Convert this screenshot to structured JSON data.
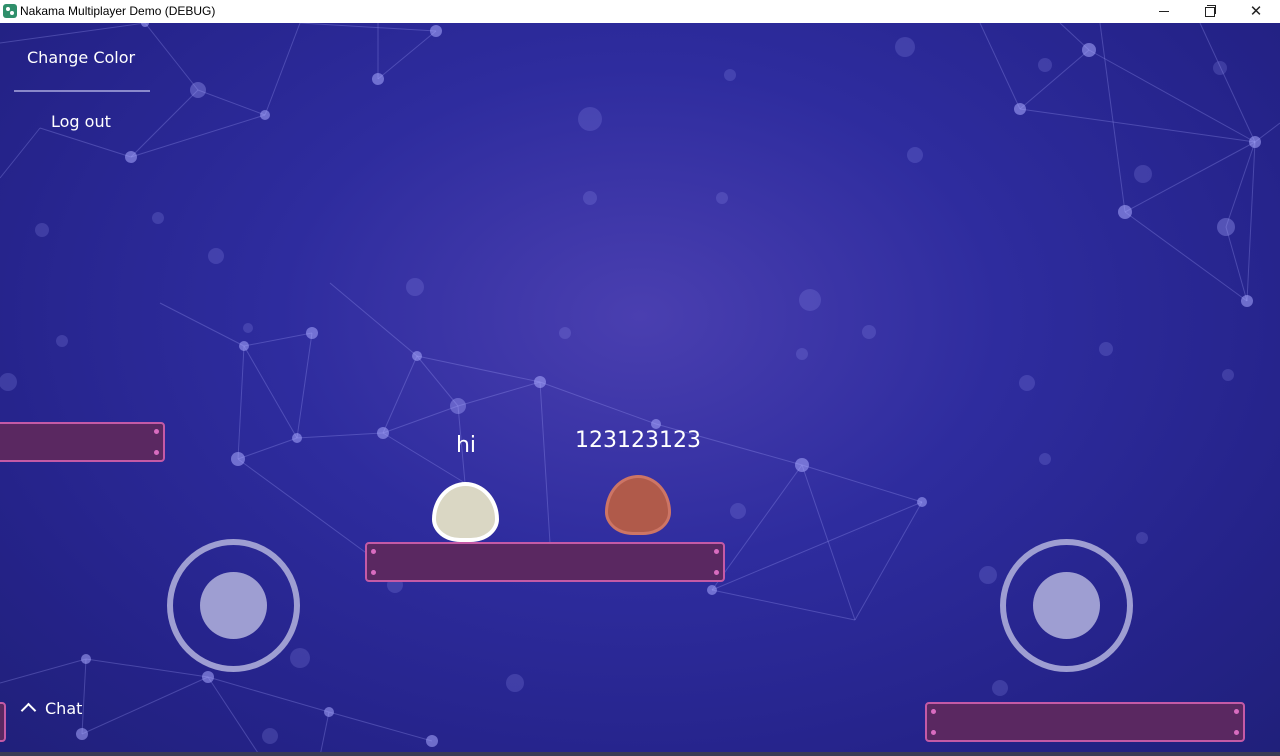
{
  "window": {
    "title": "Nakama Multiplayer Demo (DEBUG)",
    "minimize_glyph": "",
    "maximize_glyph": "",
    "close_glyph": "✕"
  },
  "menu": {
    "change_color": "Change Color",
    "log_out": "Log out"
  },
  "players": [
    {
      "name": "hi",
      "color": "#dad7c4",
      "outline": "#ffffff"
    },
    {
      "name": "123123123",
      "color": "#b05a4a",
      "outline": "#cd7565"
    }
  ],
  "chat": {
    "label": "Chat"
  },
  "colors": {
    "background": "#2e2c9e",
    "platform_fill": "#5a2861",
    "platform_border": "#c45aa6",
    "joystick": "#9e9ed2"
  },
  "icons": {
    "app": "nakama-app-icon",
    "chat_toggle": "chevron-up-icon"
  }
}
